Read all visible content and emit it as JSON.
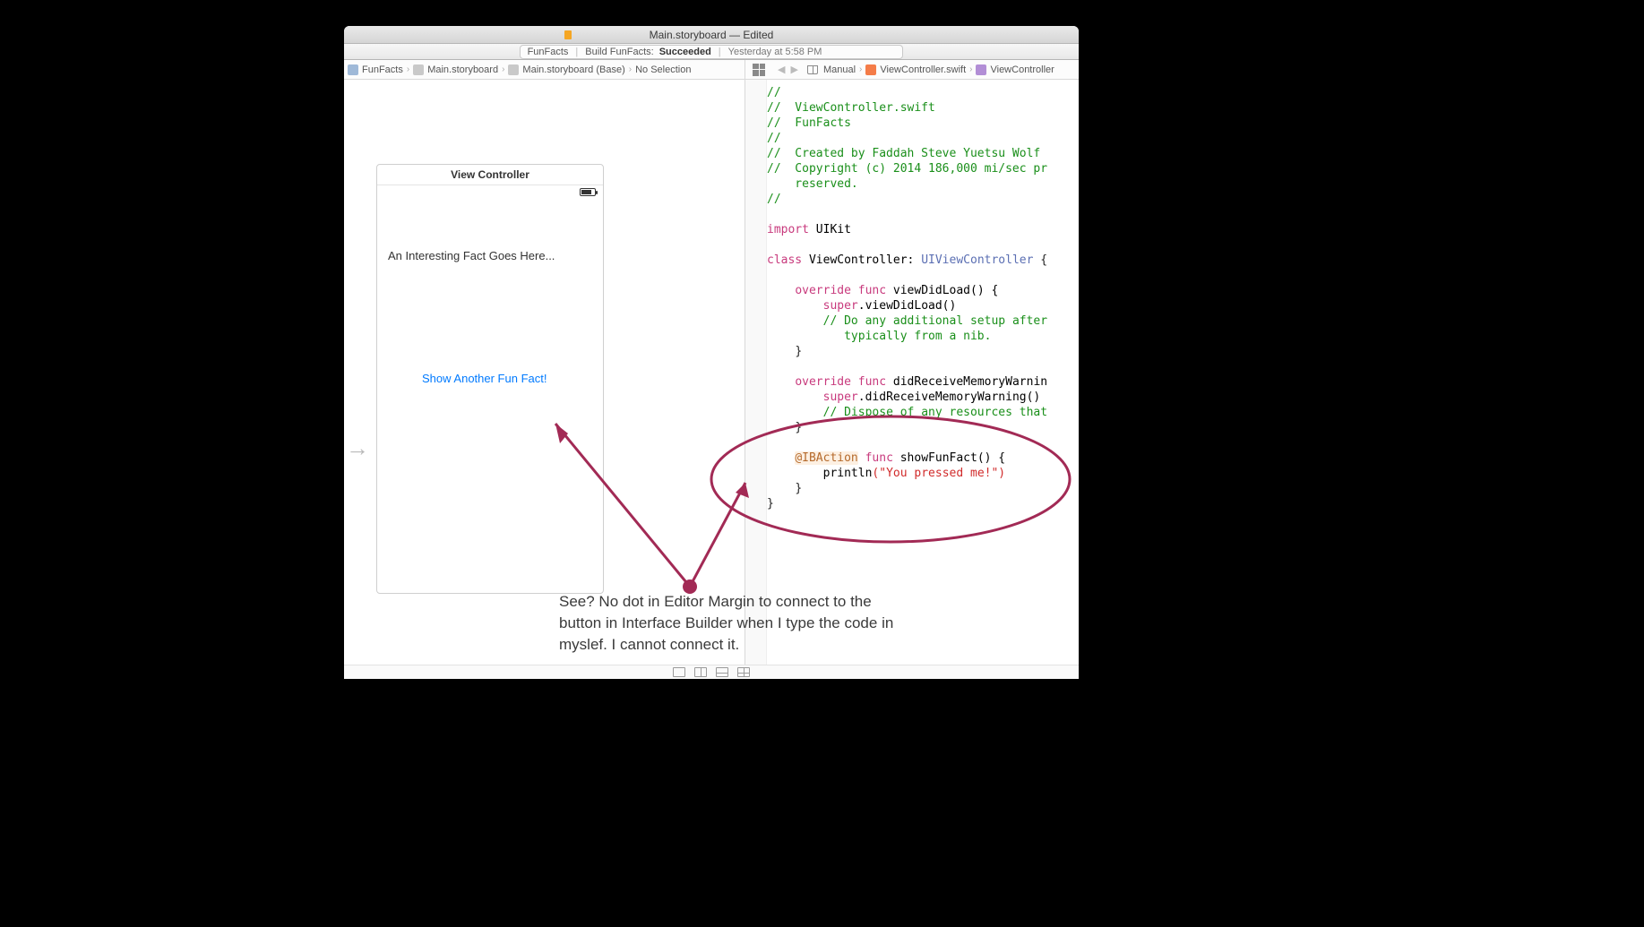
{
  "window": {
    "title": "Main.storyboard — Edited"
  },
  "build_bar": {
    "project": "FunFacts",
    "action_prefix": "Build FunFacts:",
    "status": "Succeeded",
    "timestamp": "Yesterday at 5:58 PM"
  },
  "left_breadcrumb": {
    "items": [
      "FunFacts",
      "Main.storyboard",
      "Main.storyboard (Base)",
      "No Selection"
    ]
  },
  "right_breadcrumb": {
    "manual": "Manual",
    "file": "ViewController.swift",
    "symbol": "ViewController"
  },
  "storyboard": {
    "scene_title": "View Controller",
    "fact_label": "An Interesting Fact Goes Here...",
    "button_label": "Show Another Fun Fact!"
  },
  "code": {
    "c1": "//",
    "c2": "//  ViewController.swift",
    "c3": "//  FunFacts",
    "c4": "//",
    "c5": "//  Created by Faddah Steve Yuetsu Wolf ",
    "c6": "//  Copyright (c) 2014 186,000 mi/sec pr",
    "c6b": "    reserved.",
    "c7": "//",
    "import_kw": "import",
    "import_mod": "UIKit",
    "class_kw": "class",
    "class_name": "ViewController:",
    "class_super": "UIViewController",
    "brace_open": " {",
    "override_kw": "override",
    "func_kw": "func",
    "vdl_sig": "viewDidLoad() {",
    "super_kw": "super",
    "vdl_call": ".viewDidLoad()",
    "vdl_comment1": "// Do any additional setup after",
    "vdl_comment2": "   typically from a nib.",
    "brace_close": "}",
    "mem_sig": "didReceiveMemoryWarnin",
    "mem_call": ".didReceiveMemoryWarning()",
    "mem_comment": "// Dispose of any resources that",
    "ibaction": "@IBAction",
    "show_sig": "showFunFact() {",
    "println_name": "println",
    "println_arg": "(\"You pressed me!\")"
  },
  "annotation": {
    "text": "See? No dot in Editor Margin to connect to the button in Interface Builder when I type the code in myslef. I cannot connect it."
  }
}
